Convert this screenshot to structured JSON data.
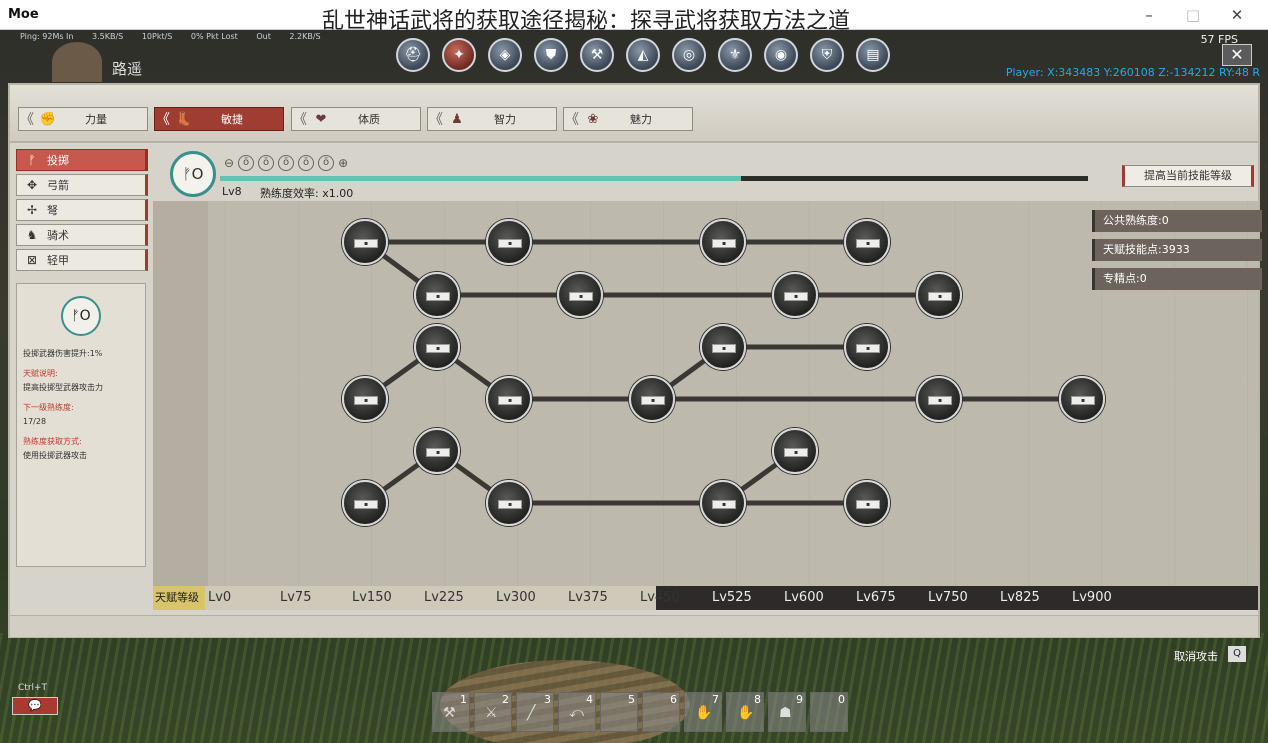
{
  "window": {
    "app_name": "Moe",
    "caption": "乱世神话武将的获取途径揭秘：探寻武将获取方法之道",
    "minimize": "–",
    "maximize": "□",
    "close": "✕"
  },
  "hud": {
    "stats": [
      "Ping: 92Ms In",
      "3.5KB/S",
      "10Pkt/S",
      "0% Pkt Lost",
      "Out",
      "2.2KB/S"
    ],
    "player_name": "路遥",
    "fps": "57 FPS",
    "coords": "Player: X:343483 Y:260108 Z:-134212 RY:48 R",
    "top_icons": [
      "helmet-icon",
      "skills-icon",
      "bag-icon",
      "armor-icon",
      "craft-icon",
      "map-icon",
      "target-icon",
      "social-icon",
      "globe-icon",
      "shield-icon",
      "book-icon"
    ],
    "active_top_icon": 1,
    "close_panel": "✕"
  },
  "attributes": [
    {
      "label": "力量",
      "icon": "✊",
      "active": false
    },
    {
      "label": "敏捷",
      "icon": "👢",
      "active": true
    },
    {
      "label": "体质",
      "icon": "❤",
      "active": false
    },
    {
      "label": "智力",
      "icon": "♟",
      "active": false
    },
    {
      "label": "魅力",
      "icon": "❀",
      "active": false
    }
  ],
  "weapons": [
    {
      "label": "投掷",
      "icon": "ᚠ",
      "active": true
    },
    {
      "label": "弓箭",
      "icon": "✥",
      "active": false
    },
    {
      "label": "弩",
      "icon": "✢",
      "active": false
    },
    {
      "label": "骑术",
      "icon": "♞",
      "active": false
    },
    {
      "label": "轻甲",
      "icon": "⊠",
      "active": false
    }
  ],
  "info": {
    "emblem": "ᚠO",
    "desc": "投掷武器伤害提升:1%",
    "talent_title": "天赋说明:",
    "talent_text": "提高投掷型武器攻击力",
    "next_title": "下一级熟练度:",
    "next_value": "17/28",
    "gain_title": "熟练度获取方式:",
    "gain_text": "使用投掷武器攻击"
  },
  "skill": {
    "emblem": "ᚠO",
    "level": "Lv8",
    "efficiency": "熟练度效率:  x1.00",
    "progress": 0.6,
    "ranks": [
      "ō",
      "ō",
      "ō",
      "ō",
      "ō"
    ],
    "upgrade_button": "提高当前技能等级"
  },
  "stats": [
    "公共熟练度:0",
    "天赋技能点:3933",
    "专精点:0"
  ],
  "level_scale": {
    "title": "天赋等级",
    "ticks": [
      "Lv0",
      "Lv75",
      "Lv150",
      "Lv225",
      "Lv300",
      "Lv375",
      "Lv450",
      "Lv525",
      "Lv600",
      "Lv675",
      "Lv750",
      "Lv825",
      "Lv900"
    ],
    "lit_fraction": 0.455
  },
  "hotbar": {
    "slots": [
      "1",
      "2",
      "3",
      "4",
      "5",
      "6",
      "7",
      "8",
      "9",
      "0"
    ]
  },
  "hints": {
    "cancel_attack": "取消攻击",
    "cancel_key": "Q",
    "ctrl_t": "Ctrl+T",
    "chat_icon": "💬"
  }
}
